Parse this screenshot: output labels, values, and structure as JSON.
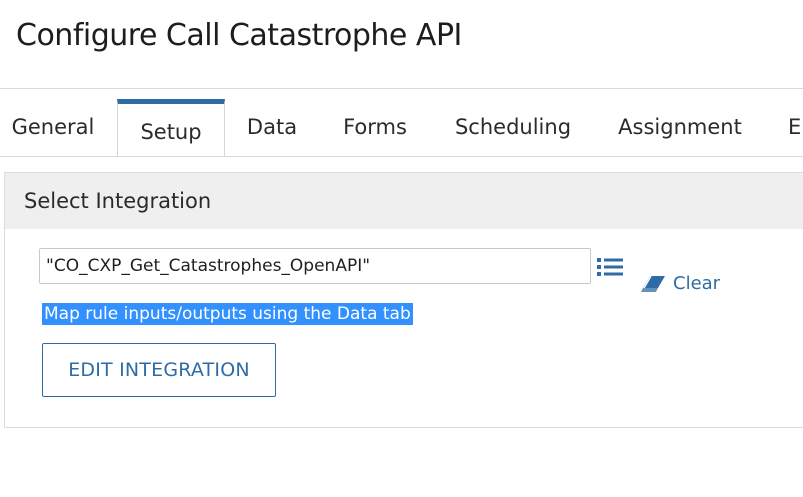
{
  "page": {
    "title": "Configure Call Catastrophe API"
  },
  "tabs": [
    {
      "label": "General",
      "active": false
    },
    {
      "label": "Setup",
      "active": true
    },
    {
      "label": "Data",
      "active": false
    },
    {
      "label": "Forms",
      "active": false
    },
    {
      "label": "Scheduling",
      "active": false
    },
    {
      "label": "Assignment",
      "active": false
    },
    {
      "label": "E",
      "active": false
    }
  ],
  "panel": {
    "title": "Select Integration",
    "integration_value": "\"CO_CXP_Get_Catastrophes_OpenAPI\"",
    "list_icon": "list-icon",
    "clear_label": "Clear",
    "clear_icon": "eraser-icon",
    "hint": "Map rule inputs/outputs using the Data tab",
    "edit_button_label": "EDIT INTEGRATION"
  },
  "colors": {
    "accent": "#2f6ca6",
    "selection": "#3390ff",
    "header_bg": "#efefef"
  }
}
